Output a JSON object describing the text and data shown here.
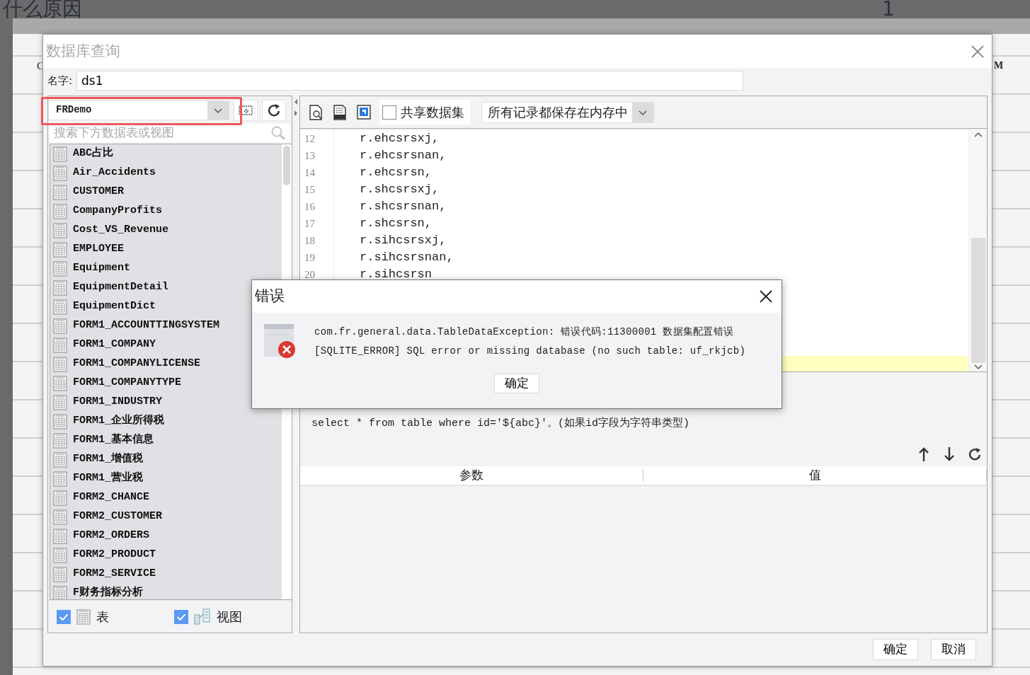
{
  "background": {
    "heading": "什么原因",
    "number": "1",
    "cell_left": "C",
    "cell_right": "M"
  },
  "window": {
    "title": "数据库查询",
    "name_label": "名字:",
    "name_value": "ds1"
  },
  "connection": {
    "value": "FRDemo",
    "highlighted": true
  },
  "search": {
    "placeholder": "搜索下方数据表或视图"
  },
  "tables": [
    {
      "name": "ABC占比"
    },
    {
      "name": "Air_Accidents"
    },
    {
      "name": "CUSTOMER"
    },
    {
      "name": "CompanyProfits"
    },
    {
      "name": "Cost_VS_Revenue"
    },
    {
      "name": "EMPLOYEE"
    },
    {
      "name": "Equipment"
    },
    {
      "name": "EquipmentDetail"
    },
    {
      "name": "EquipmentDict"
    },
    {
      "name": "FORM1_ACCOUNTTINGSYSTEM"
    },
    {
      "name": "FORM1_COMPANY"
    },
    {
      "name": "FORM1_COMPANYLICENSE"
    },
    {
      "name": "FORM1_COMPANYTYPE"
    },
    {
      "name": "FORM1_INDUSTRY"
    },
    {
      "name": "FORM1_企业所得税"
    },
    {
      "name": "FORM1_基本信息"
    },
    {
      "name": "FORM1_增值税"
    },
    {
      "name": "FORM1_营业税"
    },
    {
      "name": "FORM2_CHANCE"
    },
    {
      "name": "FORM2_CUSTOMER"
    },
    {
      "name": "FORM2_ORDERS"
    },
    {
      "name": "FORM2_PRODUCT"
    },
    {
      "name": "FORM2_SERVICE"
    },
    {
      "name": "F财务指标分析"
    }
  ],
  "filters": [
    {
      "label": "表",
      "checked": true,
      "kind": "table"
    },
    {
      "label": "视图",
      "checked": true,
      "kind": "view"
    }
  ],
  "toolbar": {
    "share_label": "共享数据集",
    "share_checked": false,
    "storage": "所有记录都保存在内存中"
  },
  "editor": {
    "lines": [
      {
        "number": "12",
        "code": "r.ehcsrsxj,"
      },
      {
        "number": "13",
        "code": "r.ehcsrsnan,"
      },
      {
        "number": "14",
        "code": "r.ehcsrsn,"
      },
      {
        "number": "15",
        "code": "r.shcsrsxj,"
      },
      {
        "number": "16",
        "code": "r.shcsrsnan,"
      },
      {
        "number": "17",
        "code": "r.shcsrsn,"
      },
      {
        "number": "18",
        "code": "r.sihcsrsxj,"
      },
      {
        "number": "19",
        "code": "r.sihcsrsnan,"
      },
      {
        "number": "20",
        "code": "r.sihcsrsn"
      }
    ]
  },
  "hint": "select * from table where id='${abc}'。(如果id字段为字符串类型)",
  "params_table": {
    "columns": [
      "参数",
      "值"
    ]
  },
  "buttons": [
    "确定",
    "取消"
  ],
  "error_dialog": {
    "title": "错误",
    "lines": [
      "com.fr.general.data.TableDataException: 错误代码:11300001 数据集配置错误",
      "[SQLITE_ERROR] SQL error or missing database (no such table: uf_rkjcb)"
    ],
    "button": "确定"
  }
}
